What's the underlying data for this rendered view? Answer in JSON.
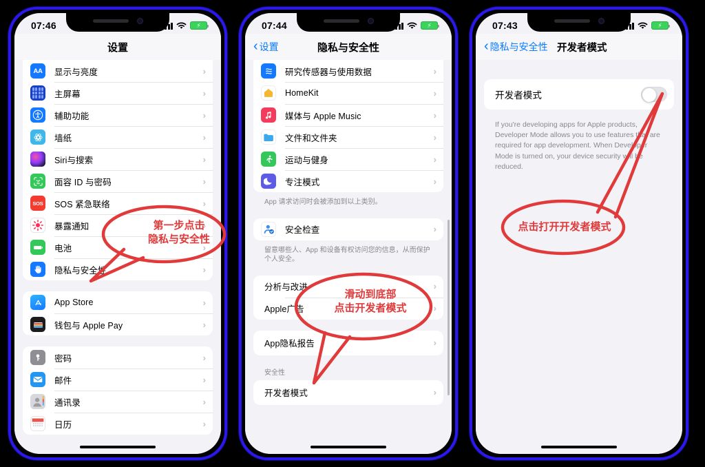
{
  "phones": [
    {
      "id": "phone-settings",
      "status": {
        "time": "07:46",
        "signal_icon": "signal-bars-icon",
        "wifi_icon": "wifi-icon",
        "battery_icon": "battery-charging-icon"
      },
      "nav": {
        "title": "设置",
        "back_label": ""
      },
      "groups": [
        {
          "rows": [
            {
              "label": "显示与亮度",
              "icon": "display-brightness-icon",
              "glyph": "AA",
              "cls": "g-AA"
            },
            {
              "label": "主屏幕",
              "icon": "home-screen-icon",
              "glyph": "",
              "cls": "g-home"
            },
            {
              "label": "辅助功能",
              "icon": "accessibility-icon",
              "glyph": "",
              "cls": "g-access"
            },
            {
              "label": "墙纸",
              "icon": "wallpaper-icon",
              "glyph": "",
              "cls": "g-wall"
            },
            {
              "label": "Siri与搜索",
              "icon": "siri-search-icon",
              "glyph": "",
              "cls": "g-siri"
            },
            {
              "label": "面容 ID 与密码",
              "icon": "face-id-icon",
              "glyph": "",
              "cls": "g-face"
            },
            {
              "label": "SOS 紧急联络",
              "icon": "emergency-sos-icon",
              "glyph": "SOS",
              "cls": "g-sos"
            },
            {
              "label": "暴露通知",
              "icon": "exposure-notifications-icon",
              "glyph": "",
              "cls": "g-expo"
            },
            {
              "label": "电池",
              "icon": "battery-icon",
              "glyph": "",
              "cls": "g-batt"
            },
            {
              "label": "隐私与安全性",
              "icon": "privacy-security-icon",
              "glyph": "",
              "cls": "g-priv"
            }
          ]
        },
        {
          "rows": [
            {
              "label": "App Store",
              "icon": "app-store-icon",
              "glyph": "",
              "cls": "g-appstore"
            },
            {
              "label": "钱包与 Apple Pay",
              "icon": "wallet-apple-pay-icon",
              "glyph": "",
              "cls": "g-wallet"
            }
          ]
        },
        {
          "rows": [
            {
              "label": "密码",
              "icon": "passwords-icon",
              "glyph": "",
              "cls": "g-pass"
            },
            {
              "label": "邮件",
              "icon": "mail-icon",
              "glyph": "",
              "cls": "g-mail"
            },
            {
              "label": "通讯录",
              "icon": "contacts-icon",
              "glyph": "",
              "cls": "g-contacts"
            },
            {
              "label": "日历",
              "icon": "calendar-icon",
              "glyph": "",
              "cls": "g-cal"
            }
          ]
        }
      ]
    },
    {
      "id": "phone-privacy",
      "status": {
        "time": "07:44",
        "signal_icon": "signal-bars-icon",
        "wifi_icon": "wifi-icon",
        "battery_icon": "battery-charging-icon"
      },
      "nav": {
        "title": "隐私与安全性",
        "back_label": "设置"
      },
      "groups": [
        {
          "rows": [
            {
              "label": "研究传感器与使用数据",
              "icon": "research-sensor-icon",
              "glyph": "",
              "cls": "g-research"
            },
            {
              "label": "HomeKit",
              "icon": "homekit-icon",
              "glyph": "",
              "cls": "g-homekit"
            },
            {
              "label": "媒体与 Apple Music",
              "icon": "apple-music-icon",
              "glyph": "",
              "cls": "g-music"
            },
            {
              "label": "文件和文件夹",
              "icon": "files-folders-icon",
              "glyph": "",
              "cls": "g-files"
            },
            {
              "label": "运动与健身",
              "icon": "fitness-icon",
              "glyph": "",
              "cls": "g-fitness"
            },
            {
              "label": "专注模式",
              "icon": "focus-mode-icon",
              "glyph": "",
              "cls": "g-focus"
            }
          ],
          "footnote": "App 请求访问时会被添加到以上类别。"
        },
        {
          "rows": [
            {
              "label": "安全检查",
              "icon": "safety-check-icon",
              "glyph": "",
              "cls": "g-safety"
            }
          ],
          "footnote": "留意哪些人、App 和设备有权访问您的信息，从而保护个人安全。"
        },
        {
          "rows": [
            {
              "label": "分析与改进",
              "icon": "",
              "glyph": "",
              "cls": ""
            },
            {
              "label": "Apple广告",
              "icon": "",
              "glyph": "",
              "cls": ""
            }
          ]
        },
        {
          "rows": [
            {
              "label": "App隐私报告",
              "icon": "",
              "glyph": "",
              "cls": ""
            }
          ]
        },
        {
          "header": "安全性",
          "rows": [
            {
              "label": "开发者模式",
              "icon": "",
              "glyph": "",
              "cls": ""
            }
          ]
        }
      ]
    },
    {
      "id": "phone-developer-mode",
      "status": {
        "time": "07:43",
        "signal_icon": "signal-bars-icon",
        "wifi_icon": "wifi-icon",
        "battery_icon": "battery-charging-icon"
      },
      "nav": {
        "title": "开发者模式",
        "back_label": "隐私与安全性"
      },
      "toggle_row": {
        "label": "开发者模式",
        "state": "off"
      },
      "description": "If you're developing apps for Apple products, Developer Mode allows you to use features that are required for app development. When Developer Mode is turned on, your device security will be reduced."
    }
  ],
  "annotations": [
    {
      "id": "callout-step-1",
      "text": "第一步点击\n隐私与安全性",
      "color": "#e03a3a"
    },
    {
      "id": "callout-step-2",
      "text": "滑动到底部\n点击开发者模式",
      "color": "#e03a3a"
    },
    {
      "id": "callout-step-3",
      "text": "点击打开开发者模式",
      "color": "#e03a3a"
    }
  ]
}
